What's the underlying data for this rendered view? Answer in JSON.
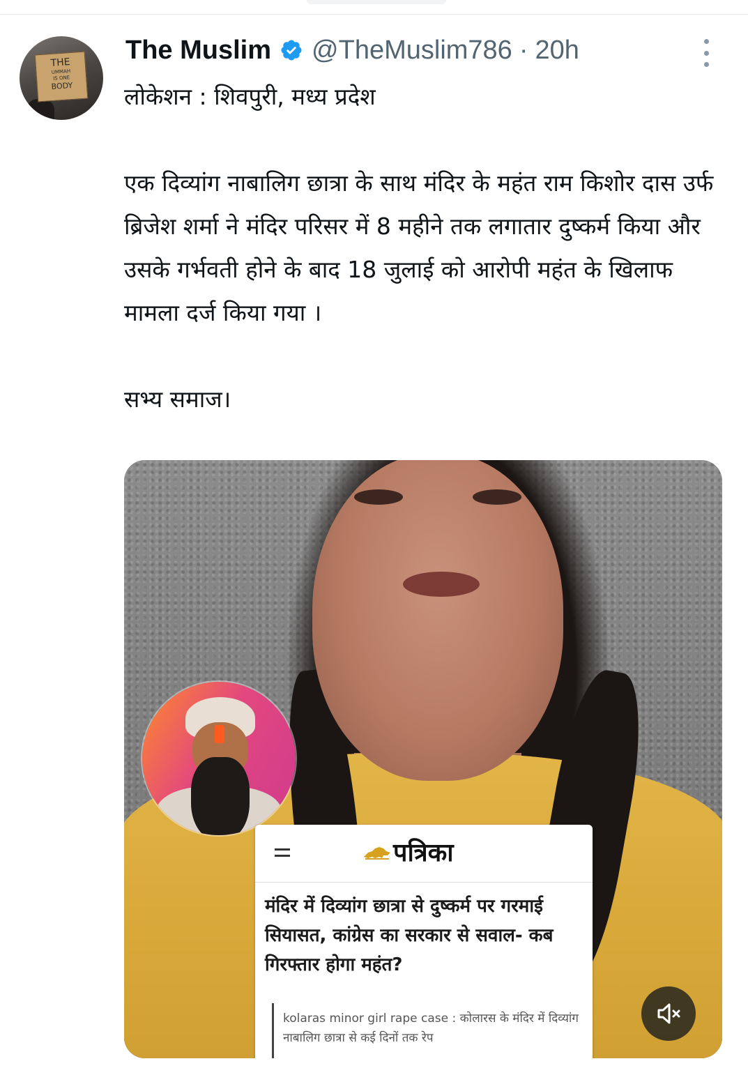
{
  "tweet": {
    "author": {
      "display_name": "The Muslim",
      "handle": "@TheMuslim786",
      "separator": "·",
      "time": "20h",
      "verified": true,
      "avatar_sign": [
        "THE",
        "UMMAH",
        "IS ONE",
        "BODY"
      ]
    },
    "location_line": "लोकेशन : शिवपुरी, मध्य प्रदेश",
    "body": "एक दिव्यांग नाबालिग छात्रा के साथ मंदिर के महंत राम किशोर दास उर्फ ब्रिजेश शर्मा ने मंदिर परिसर में 8 महीने तक लगातार दुष्कर्म किया और उसके गर्भवती होने के बाद 18 जुलाई को आरोपी महंत के खिलाफ मामला दर्ज किया गया ।",
    "closing": "सभ्य समाज।"
  },
  "media": {
    "news_card": {
      "brand": "पत्रिका",
      "menu_glyph": "=",
      "headline": "मंदिर में दिव्यांग छात्रा से दुष्कर्म पर गरमाई सियासत, कांग्रेस का सरकार से सवाल- कब गिरफ्तार होगा महंत?",
      "excerpt": "kolaras minor girl rape case : कोलारस के मंदिर में दिव्यांग नाबालिग छात्रा से कई दिनों तक रेप"
    },
    "mute_icon": "speaker-muted-icon"
  },
  "colors": {
    "verified_blue": "#1d9bf0",
    "secondary_text": "#536471",
    "primary_text": "#0f1419"
  }
}
